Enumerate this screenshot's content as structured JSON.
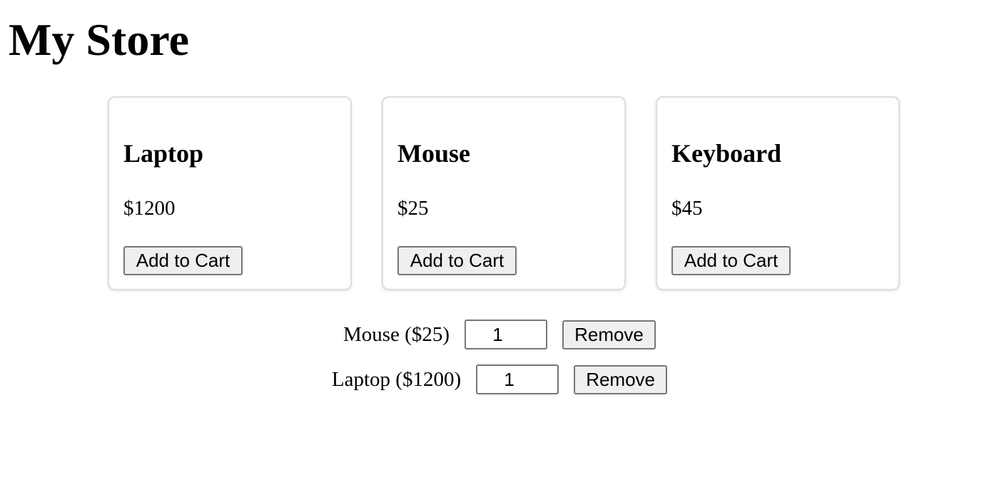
{
  "store": {
    "title": "My Store"
  },
  "products": [
    {
      "name": "Laptop",
      "price": "$1200",
      "button_label": "Add to Cart"
    },
    {
      "name": "Mouse",
      "price": "$25",
      "button_label": "Add to Cart"
    },
    {
      "name": "Keyboard",
      "price": "$45",
      "button_label": "Add to Cart"
    }
  ],
  "cart": {
    "items": [
      {
        "label": "Mouse ($25)",
        "quantity": "1",
        "remove_label": "Remove"
      },
      {
        "label": "Laptop ($1200)",
        "quantity": "1",
        "remove_label": "Remove"
      }
    ]
  }
}
